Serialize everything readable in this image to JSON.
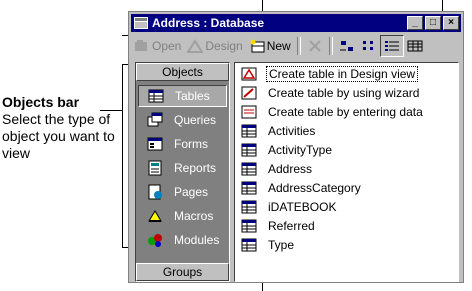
{
  "callout": {
    "title": "Objects bar",
    "text": "Select the type of object you want to view"
  },
  "window": {
    "title": "Address : Database"
  },
  "toolbar": {
    "open_label": "Open",
    "design_label": "Design",
    "new_label": "New"
  },
  "objects_bar": {
    "header": "Objects",
    "items": [
      {
        "label": "Tables",
        "icon": "table-icon",
        "selected": true
      },
      {
        "label": "Queries",
        "icon": "query-icon"
      },
      {
        "label": "Forms",
        "icon": "form-icon"
      },
      {
        "label": "Reports",
        "icon": "report-icon"
      },
      {
        "label": "Pages",
        "icon": "page-icon"
      },
      {
        "label": "Macros",
        "icon": "macro-icon"
      },
      {
        "label": "Modules",
        "icon": "module-icon"
      }
    ],
    "groups_label": "Groups"
  },
  "list": {
    "items": [
      {
        "label": "Create table in Design view",
        "kind": "shortcut"
      },
      {
        "label": "Create table by using wizard",
        "kind": "shortcut"
      },
      {
        "label": "Create table by entering data",
        "kind": "shortcut"
      },
      {
        "label": "Activities",
        "kind": "table"
      },
      {
        "label": "ActivityType",
        "kind": "table"
      },
      {
        "label": "Address",
        "kind": "table"
      },
      {
        "label": "AddressCategory",
        "kind": "table"
      },
      {
        "label": "iDATEBOOK",
        "kind": "table"
      },
      {
        "label": "Referred",
        "kind": "table"
      },
      {
        "label": "Type",
        "kind": "table"
      }
    ]
  },
  "colors": {
    "title_bar": "#000080",
    "object_bar": "#808080"
  }
}
